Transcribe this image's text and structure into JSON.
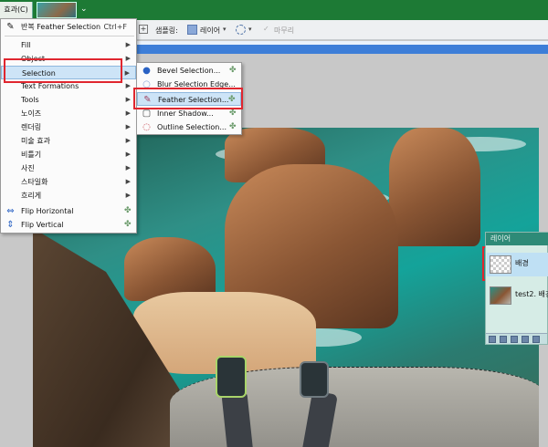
{
  "app": {
    "menu_effects_label": "효과(C)"
  },
  "toolbar": {
    "sampling_label": "샘플링:",
    "layer_label": "레이어",
    "finish_label": "마무리"
  },
  "effects_menu": {
    "items": [
      {
        "label": "반복 Feather Selection",
        "shortcut": "Ctrl+F",
        "icon": "feather-icon"
      },
      {
        "label": "Fill",
        "submenu": true
      },
      {
        "label": "Object",
        "submenu": true
      },
      {
        "label": "Selection",
        "submenu": true,
        "active": true
      },
      {
        "label": "Text Formations",
        "submenu": true
      },
      {
        "label": "Tools",
        "submenu": true
      },
      {
        "label": "노이즈",
        "submenu": true
      },
      {
        "label": "렌더링",
        "submenu": true
      },
      {
        "label": "미술 효과",
        "submenu": true
      },
      {
        "label": "비틀기",
        "submenu": true
      },
      {
        "label": "사진",
        "submenu": true
      },
      {
        "label": "스타일화",
        "submenu": true
      },
      {
        "label": "흐리게",
        "submenu": true
      },
      {
        "label": "Flip Horizontal",
        "icon": "flip-horizontal-icon",
        "plugin": true
      },
      {
        "label": "Flip Vertical",
        "icon": "flip-vertical-icon",
        "plugin": true
      }
    ]
  },
  "selection_submenu": {
    "items": [
      {
        "label": "Bevel Selection...",
        "icon": "bevel-icon"
      },
      {
        "label": "Blur Selection Edge...",
        "icon": "blur-edge-icon"
      },
      {
        "label": "Feather Selection...",
        "icon": "feather-icon",
        "active": true
      },
      {
        "label": "Inner Shadow...",
        "icon": "inner-shadow-icon"
      },
      {
        "label": "Outline Selection...",
        "icon": "outline-icon"
      }
    ]
  },
  "layers_panel": {
    "title": "레이어",
    "layers": [
      {
        "name": "배경",
        "selected": true
      },
      {
        "name": "test2. 배경"
      }
    ]
  },
  "colors": {
    "app_bar": "#1d7a35",
    "highlight_box": "#e0262f",
    "menu_active": "#cde4f7",
    "layers_title": "#2e8a77"
  }
}
